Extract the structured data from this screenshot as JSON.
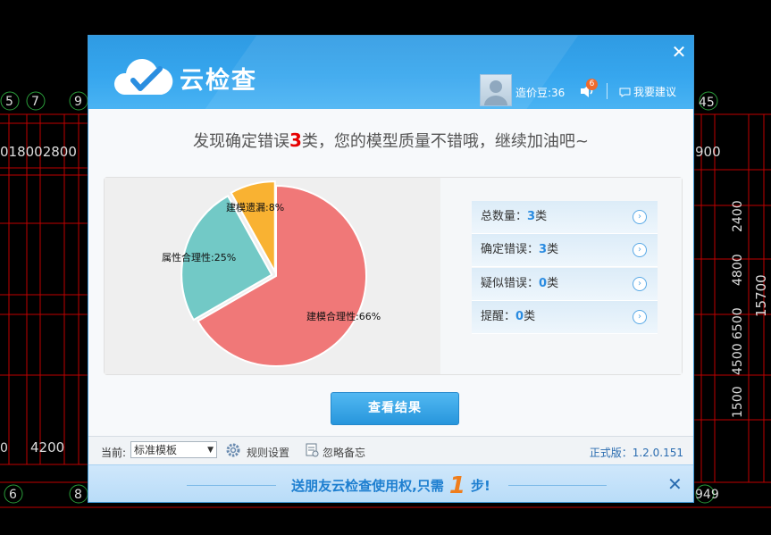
{
  "background": {
    "cad_texts": [
      "5",
      "7",
      "9",
      "018002800",
      "4200",
      "6",
      "8",
      "45",
      "900",
      "15700",
      "4500",
      "1500",
      "6500",
      "2400",
      "4800",
      "0",
      "949"
    ]
  },
  "window": {
    "title": "云检查",
    "close_icon": "close-icon",
    "user_label": "造价豆:36",
    "notification_count": "6",
    "suggest_label": "我要建议"
  },
  "summary": {
    "prefix": "发现确定错误",
    "count": "3",
    "suffix": "类，您的模型质量不错哦，继续加油吧~"
  },
  "chart_data": {
    "type": "pie",
    "slices": [
      {
        "label": "建模合理性",
        "value": 66,
        "display": "建模合理性:66%",
        "color": "#f07878"
      },
      {
        "label": "属性合理性",
        "value": 25,
        "display": "属性合理性:25%",
        "color": "#72c9c6"
      },
      {
        "label": "建模遗漏",
        "value": 8,
        "display": "建模遗漏:8%",
        "color": "#f9b232"
      }
    ]
  },
  "stats": [
    {
      "label": "总数量：",
      "value": "3",
      "unit": "类"
    },
    {
      "label": "确定错误：",
      "value": "3",
      "unit": "类"
    },
    {
      "label": "疑似错误：",
      "value": "0",
      "unit": "类"
    },
    {
      "label": "提醒：",
      "value": "0",
      "unit": "类"
    }
  ],
  "view_button": "查看结果",
  "footer": {
    "current_label": "当前:",
    "template_value": "标准模板",
    "rules_label": "规则设置",
    "memo_label": "忽略备忘",
    "version": "正式版：1.2.0.151"
  },
  "banner": {
    "text_before": "送朋友云检查使用权,只需",
    "steps": "1",
    "text_after": "步!"
  },
  "colors": {
    "title_bar": "#36a6ee",
    "accent": "#2796dc",
    "error_red": "#e60000",
    "banner_orange": "#ef7d1c"
  }
}
